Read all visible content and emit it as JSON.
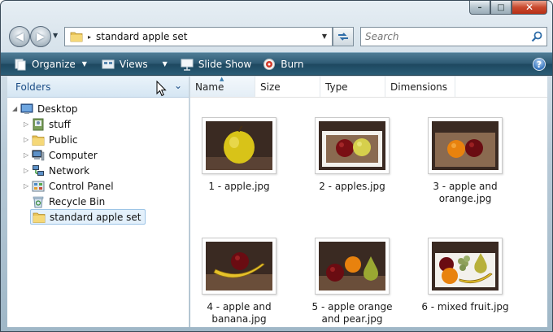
{
  "window": {
    "caption_buttons": {
      "minimize": "–",
      "maximize": "□",
      "close": "✕"
    }
  },
  "address_bar": {
    "separator": "▸",
    "path": "standard apple set",
    "dropdown": "▼"
  },
  "search": {
    "placeholder": "Search"
  },
  "command_bar": {
    "items": [
      {
        "label": "Organize",
        "icon": "organize-icon",
        "has_dropdown": true
      },
      {
        "label": "Views",
        "icon": "views-icon",
        "has_dropdown": true
      },
      {
        "label": "Slide Show",
        "icon": "slideshow-icon",
        "has_dropdown": false
      },
      {
        "label": "Burn",
        "icon": "burn-icon",
        "has_dropdown": false
      }
    ],
    "help": "?"
  },
  "folders_pane": {
    "title": "Folders",
    "tree": [
      {
        "label": "Desktop",
        "icon": "desktop-icon",
        "expanded": true
      },
      {
        "label": "stuff",
        "icon": "user-folder-icon"
      },
      {
        "label": "Public",
        "icon": "folder-icon"
      },
      {
        "label": "Computer",
        "icon": "computer-icon"
      },
      {
        "label": "Network",
        "icon": "network-icon"
      },
      {
        "label": "Control Panel",
        "icon": "control-panel-icon"
      },
      {
        "label": "Recycle Bin",
        "icon": "recycle-bin-icon"
      },
      {
        "label": "standard apple set",
        "icon": "folder-icon",
        "selected": true
      }
    ]
  },
  "columns": [
    "Name",
    "Size",
    "Type",
    "Dimensions"
  ],
  "files": [
    {
      "caption": "1 - apple.jpg",
      "fruits": [
        "yellow-apple"
      ]
    },
    {
      "caption": "2 - apples.jpg",
      "fruits": [
        "red-apple",
        "yellow-apple"
      ]
    },
    {
      "caption": "3 - apple and orange.jpg",
      "fruits": [
        "orange",
        "red-apple"
      ]
    },
    {
      "caption": "4 - apple and banana.jpg",
      "fruits": [
        "banana",
        "red-apple"
      ]
    },
    {
      "caption": "5 - apple orange and pear.jpg",
      "fruits": [
        "red-apple",
        "orange",
        "pear"
      ]
    },
    {
      "caption": "6 - mixed fruit.jpg",
      "fruits": [
        "red-apple",
        "grapes",
        "orange",
        "pear",
        "banana"
      ]
    }
  ],
  "colors": {
    "command_bar": "#2e5a74",
    "selection": "#e3f0fb",
    "photo_background": "#3a2a22",
    "placemat": "#8a6a50"
  }
}
